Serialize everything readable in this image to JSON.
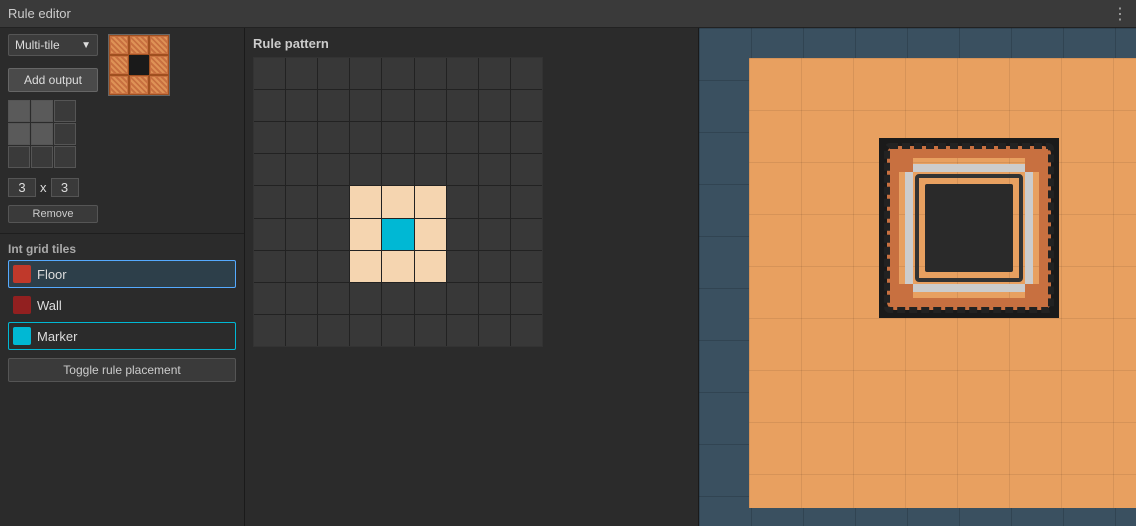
{
  "titleBar": {
    "title": "Rule editor",
    "menuIcon": "⋮"
  },
  "topControls": {
    "dropdownLabel": "Multi-tile",
    "addOutputLabel": "Add output",
    "tileSizeX": "3",
    "tileSizeY": "3",
    "tileSizeSep": "x",
    "removeLabel": "Remove"
  },
  "intGridSection": {
    "sectionLabel": "Int grid tiles",
    "tiles": [
      {
        "name": "Floor",
        "color": "#c0392b",
        "selected": true
      },
      {
        "name": "Wall",
        "color": "#922020",
        "selected": false
      },
      {
        "name": "Marker",
        "color": "#00b8d4",
        "selected": false
      }
    ]
  },
  "rulePattern": {
    "label": "Rule pattern",
    "gridCols": 9,
    "gridRows": 9,
    "highlightedCells": [
      {
        "row": 4,
        "col": 3,
        "type": "floor"
      },
      {
        "row": 4,
        "col": 4,
        "type": "floor"
      },
      {
        "row": 4,
        "col": 5,
        "type": "floor"
      },
      {
        "row": 5,
        "col": 3,
        "type": "floor"
      },
      {
        "row": 5,
        "col": 4,
        "type": "marker"
      },
      {
        "row": 5,
        "col": 5,
        "type": "floor"
      },
      {
        "row": 6,
        "col": 3,
        "type": "floor"
      },
      {
        "row": 6,
        "col": 4,
        "type": "floor"
      },
      {
        "row": 6,
        "col": 5,
        "type": "floor"
      }
    ]
  },
  "toggleRule": {
    "label": "Toggle rule placement"
  },
  "colors": {
    "floor": "#f5d5b0",
    "marker": "#00b8d4",
    "wall": "#922020",
    "tileSelected": "#c0392b"
  }
}
